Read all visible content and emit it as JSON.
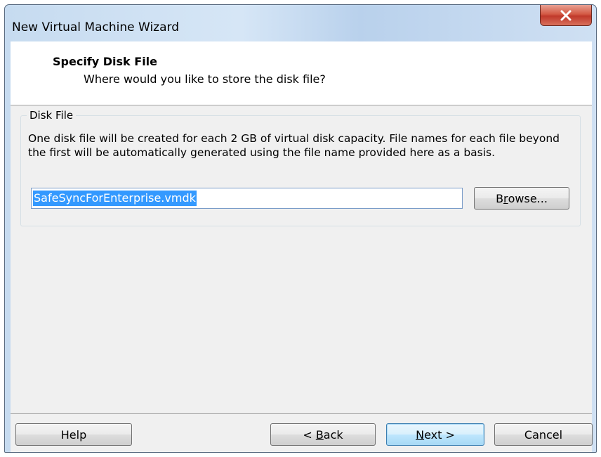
{
  "window": {
    "title": "New Virtual Machine Wizard"
  },
  "header": {
    "title": "Specify Disk File",
    "subtitle": "Where would you like to store the disk file?"
  },
  "disk_file_group": {
    "legend": "Disk File",
    "description": "One disk file will be created for each 2 GB of virtual disk capacity. File names for each file beyond the first will be automatically generated using the file name provided here as a basis.",
    "file_name_value": "SafeSyncForEnterprise.vmdk",
    "browse_label_prefix": "B",
    "browse_label_mnemonic": "r",
    "browse_label_suffix": "owse..."
  },
  "footer": {
    "help_label": "Help",
    "back_label_prefix": "< ",
    "back_label_mnemonic": "B",
    "back_label_suffix": "ack",
    "next_label_mnemonic": "N",
    "next_label_suffix": "ext >",
    "cancel_label": "Cancel"
  },
  "colors": {
    "selection": "#3399ff",
    "close_button": "#c0392b",
    "default_button_border": "#3c7fb1"
  },
  "icons": {
    "close": "close-icon"
  }
}
